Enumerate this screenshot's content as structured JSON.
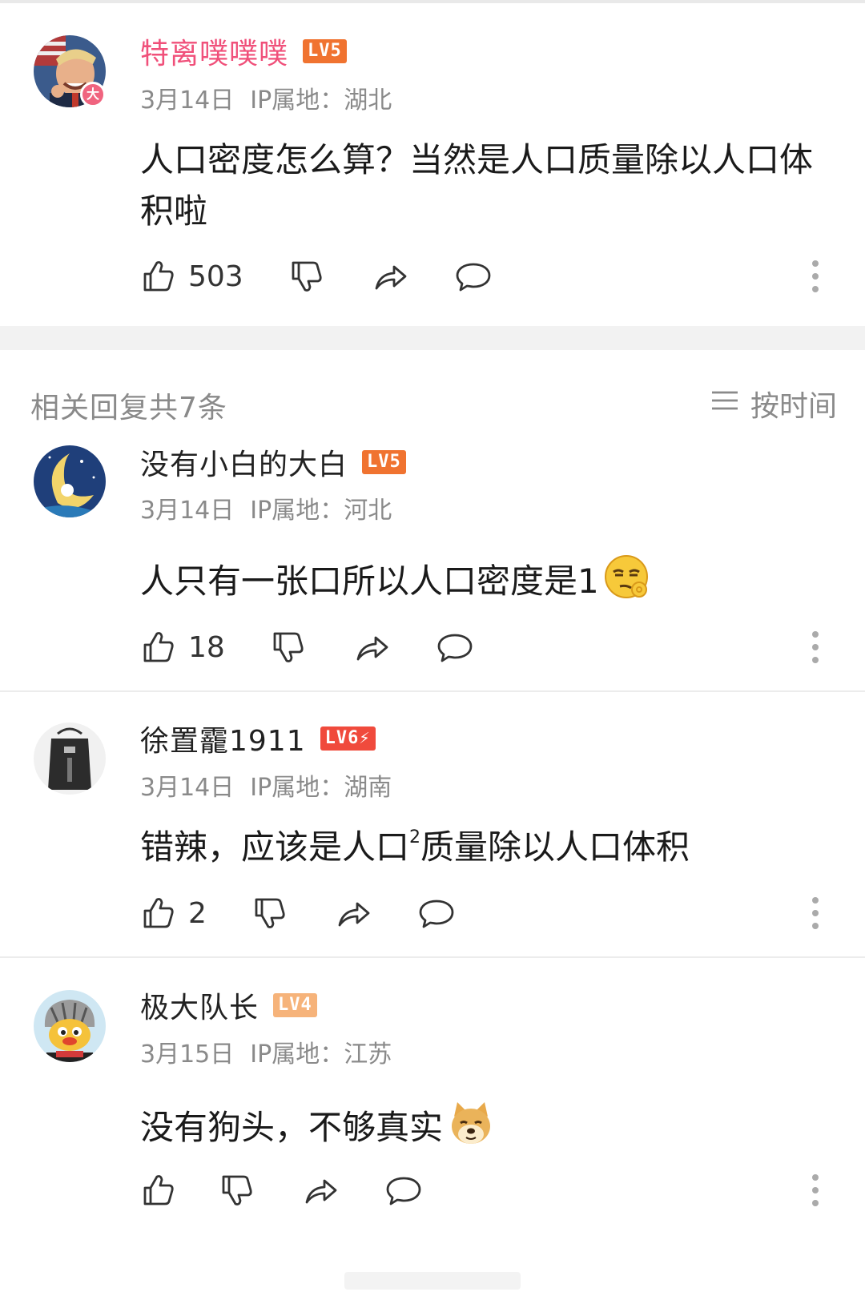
{
  "main_comment": {
    "username": "特离噗噗噗",
    "level": "LV5",
    "avatar_badge": "大",
    "date": "3月14日",
    "ip_location": "IP属地：湖北",
    "text": "人口密度怎么算？当然是人口质量除以人口体积啦",
    "likes": "503"
  },
  "replies_header": "相关回复共7条",
  "sort_label": "按时间",
  "replies": [
    {
      "username": "没有小白的大白",
      "level": "LV5",
      "date": "3月14日",
      "ip_location": "IP属地：河北",
      "text": "人只有一张口所以人口密度是1",
      "emoji": "smirk-ok-emoji",
      "likes": "18"
    },
    {
      "username": "徐置靇1911",
      "level": "LV6⚡",
      "date": "3月14日",
      "ip_location": "IP属地：湖南",
      "text_before": "错辣，应该是人口",
      "text_sup": "2",
      "text_after": "质量除以人口体积",
      "likes": "2"
    },
    {
      "username": "极大队长",
      "level": "LV4",
      "date": "3月15日",
      "ip_location": "IP属地：江苏",
      "text": "没有狗头，不够真实",
      "emoji": "doge-emoji",
      "likes": ""
    }
  ],
  "icons": {
    "like": "thumbs-up-icon",
    "dislike": "thumbs-down-icon",
    "share": "share-icon",
    "reply": "comment-icon",
    "more": "more-vertical-icon",
    "sort": "menu-lines-icon"
  },
  "colors": {
    "pink_name": "#f0507a",
    "lv5": "#f07330",
    "lv6": "#f04a3c",
    "lv4": "#f6b37a",
    "meta_gray": "#8a8a8a"
  }
}
